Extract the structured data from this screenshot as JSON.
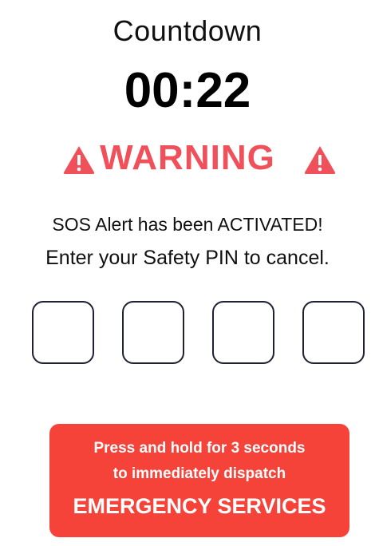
{
  "countdown": {
    "label": "Countdown",
    "time": "00:22"
  },
  "warning": {
    "title": "WARNING",
    "icon": "warning-triangle-icon",
    "color": "#f0505a"
  },
  "message": {
    "alert": "SOS Alert has been ACTIVATED!",
    "instruction": "Enter your Safety PIN to cancel."
  },
  "pin": {
    "digits": [
      "",
      "",
      "",
      ""
    ]
  },
  "emergency_button": {
    "line1": "Press and hold for 3 seconds",
    "line2": "to immediately dispatch",
    "line3": "EMERGENCY SERVICES",
    "color": "#f5433a"
  }
}
